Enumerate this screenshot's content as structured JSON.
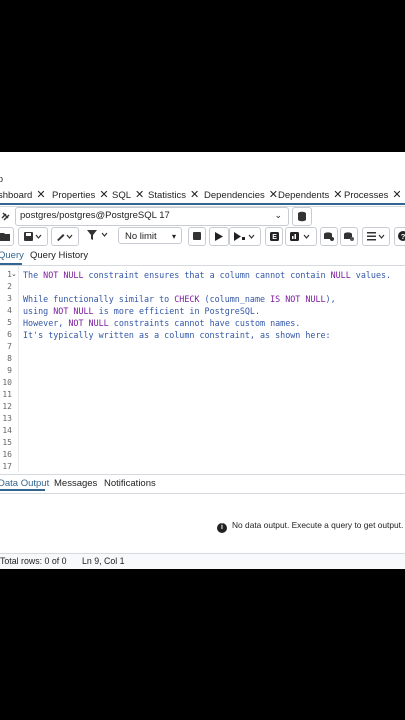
{
  "breadcrumb": "p",
  "tabs": [
    {
      "label": "shboard"
    },
    {
      "label": "Properties"
    },
    {
      "label": "SQL"
    },
    {
      "label": "Statistics"
    },
    {
      "label": "Dependencies"
    },
    {
      "label": "Dependents"
    },
    {
      "label": "Processes"
    }
  ],
  "tab_close": "✕",
  "connection": {
    "value": "postgres/postgres@PostgreSQL 17"
  },
  "toolbar": {
    "limit_label": "No limit"
  },
  "query_tabs": [
    {
      "label": "Query"
    },
    {
      "label": "Query History"
    }
  ],
  "editor": {
    "line_numbers": [
      "1",
      "2",
      "3",
      "4",
      "5",
      "6",
      "7",
      "8",
      "9",
      "10",
      "11",
      "12",
      "13",
      "14",
      "15",
      "16",
      "17"
    ],
    "lines": [
      "The NOT NULL constraint ensures that a column cannot contain NULL values.",
      "",
      "While functionally similar to CHECK (column_name IS NOT NULL),",
      "using NOT NULL is more efficient in PostgreSQL.",
      "However, NOT NULL constraints cannot have custom names.",
      "It's typically written as a column constraint, as shown here:"
    ]
  },
  "output_tabs": [
    {
      "label": "Data Output"
    },
    {
      "label": "Messages"
    },
    {
      "label": "Notifications"
    }
  ],
  "no_data_message": "No data output. Execute a query to get output.",
  "status": {
    "rows": "Total rows: 0 of 0",
    "position": "Ln 9, Col 1"
  },
  "colors": {
    "accent": "#326690",
    "keyword": "#7a1c9c",
    "comment": "#3357a6"
  }
}
